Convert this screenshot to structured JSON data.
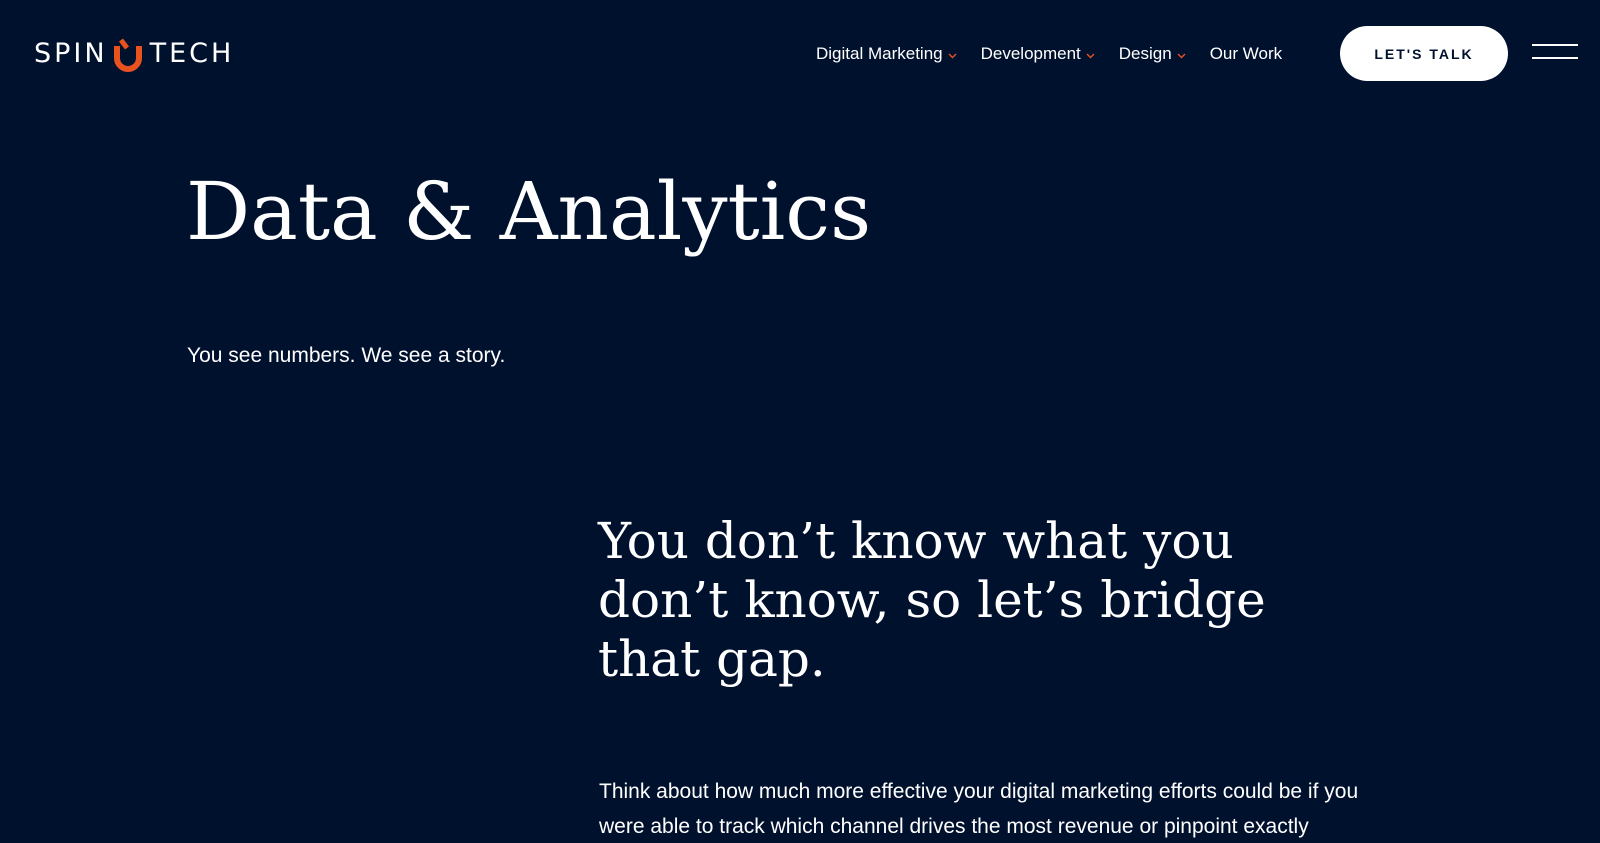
{
  "brand": {
    "name_left": "SPIN",
    "name_right": "TECH",
    "accent_color": "#e8521f",
    "background_color": "#00112e",
    "logo_icon": "spinutech-logo-mark"
  },
  "nav": {
    "items": [
      {
        "label": "Digital Marketing",
        "has_dropdown": true
      },
      {
        "label": "Development",
        "has_dropdown": true
      },
      {
        "label": "Design",
        "has_dropdown": true
      },
      {
        "label": "Our Work",
        "has_dropdown": false
      }
    ],
    "cta_label": "LET'S TALK",
    "menu_icon": "hamburger-menu-icon"
  },
  "hero": {
    "title": "Data & Analytics",
    "subtitle": "You see numbers. We see a story."
  },
  "section": {
    "heading_lines": [
      "You don’t know what you",
      "don’t know, so let’s bridge",
      "that gap."
    ],
    "body_lines": [
      "Think about how much more effective your digital marketing efforts could be if you",
      "were able to track which channel drives the most revenue or pinpoint exactly"
    ]
  }
}
